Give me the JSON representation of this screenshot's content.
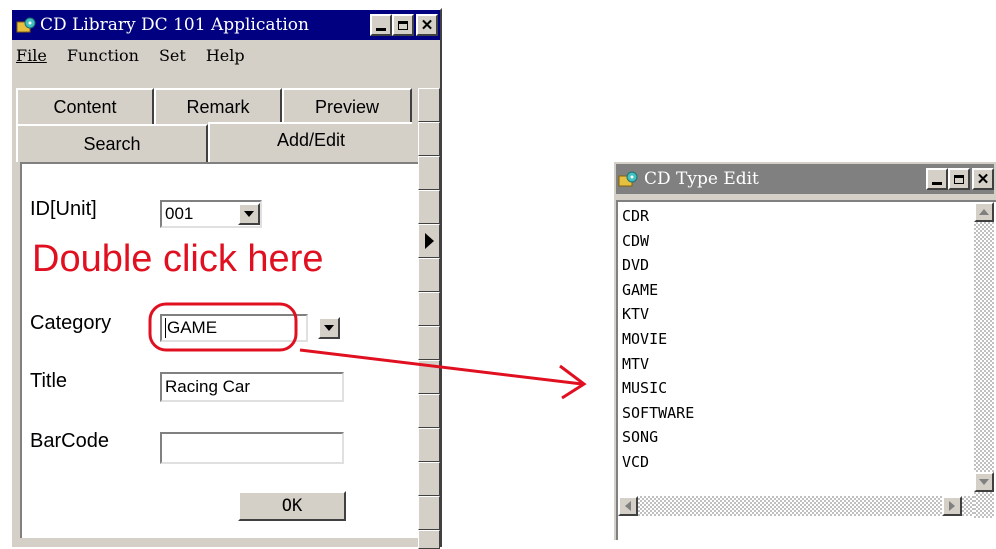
{
  "main_window": {
    "title": "CD Library DC 101 Application",
    "menu": [
      "File",
      "Function",
      "Set",
      "Help"
    ],
    "tabs_top": [
      "Content",
      "Remark",
      "Preview"
    ],
    "tabs_bottom": [
      "Search",
      "Add/Edit"
    ],
    "form": {
      "id_label": "ID[Unit]",
      "id_value": "001",
      "category_label": "Category",
      "category_value": "GAME",
      "title_label": "Title",
      "title_value": "Racing Car",
      "barcode_label": "BarCode",
      "barcode_value": "",
      "ok_label": "OK"
    }
  },
  "annotation": {
    "text": "Double click here",
    "color": "#e01020"
  },
  "type_window": {
    "title": "CD Type Edit",
    "items": [
      "CDR",
      "CDW",
      "DVD",
      "GAME",
      "KTV",
      "MOVIE",
      "MTV",
      "MUSIC",
      "SOFTWARE",
      "SONG",
      "VCD"
    ]
  },
  "colors": {
    "titlebar_active": "#000080",
    "titlebar_inactive": "#808080",
    "face": "#d4d0c8"
  }
}
